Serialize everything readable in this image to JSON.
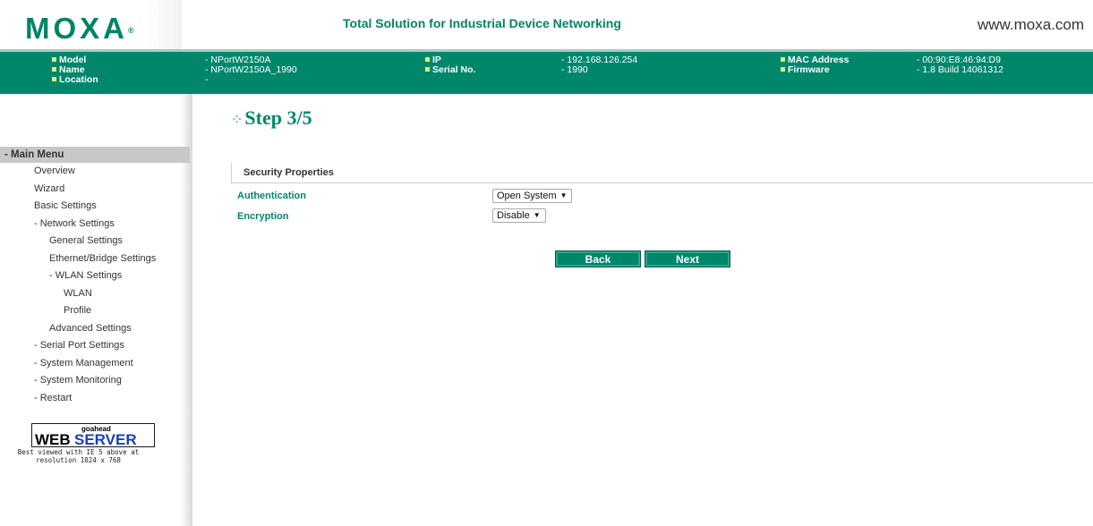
{
  "header": {
    "logo": "MOXA",
    "logo_mark": "®",
    "tagline": "Total Solution for Industrial Device Networking",
    "website": "www.moxa.com"
  },
  "infobar": {
    "model_label": "Model",
    "model_value": "- NPortW2150A",
    "name_label": "Name",
    "name_value": "- NPortW2150A_1990",
    "location_label": "Location",
    "location_value": "-",
    "ip_label": "IP",
    "ip_value": "- 192.168.126.254",
    "serial_label": "Serial No.",
    "serial_value": "- 1990",
    "mac_label": "MAC Address",
    "mac_value": "- 00:90:E8:46:94:D9",
    "firmware_label": "Firmware",
    "firmware_value": "- 1.8 Build 14061312"
  },
  "sidebar": {
    "header": "- Main Menu",
    "items": [
      {
        "label": "Overview"
      },
      {
        "label": "Wizard"
      },
      {
        "label": "Basic Settings"
      },
      {
        "label": "- Network Settings"
      },
      {
        "label": "General Settings"
      },
      {
        "label": "Ethernet/Bridge Settings"
      },
      {
        "label": "- WLAN Settings"
      },
      {
        "label": "WLAN"
      },
      {
        "label": "Profile"
      },
      {
        "label": "Advanced Settings"
      },
      {
        "label": "- Serial Port Settings"
      },
      {
        "label": "- System Management"
      },
      {
        "label": "- System Monitoring"
      },
      {
        "label": "- Restart"
      }
    ],
    "badge": {
      "goahead": "goahead",
      "web": "WEB",
      "server": "SERVER",
      "note_line1": "Best viewed with IE 5 above at",
      "note_line2": "resolution 1024 x 768"
    }
  },
  "main": {
    "step_title": "Step 3/5",
    "section_title": "Security Properties",
    "fields": {
      "authentication_label": "Authentication",
      "authentication_value": "Open System",
      "encryption_label": "Encryption",
      "encryption_value": "Disable"
    },
    "buttons": {
      "back": "Back",
      "next": "Next"
    }
  },
  "colors": {
    "brand_green": "#00876b",
    "bullet": "#d6f27a"
  }
}
